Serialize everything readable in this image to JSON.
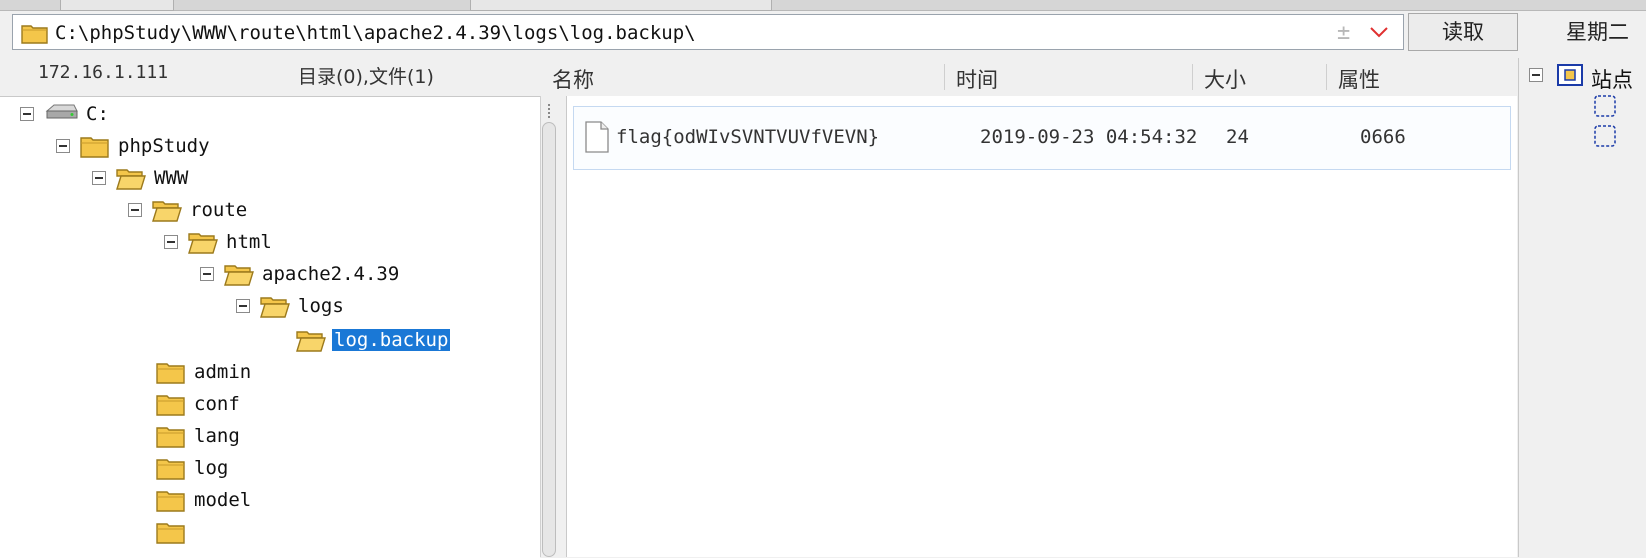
{
  "path_bar": {
    "path": "C:\\phpStudy\\WWW\\route\\html\\apache2.4.39\\logs\\log.backup\\",
    "plusminus": "±",
    "read_button": "读取"
  },
  "weekday": "星期二",
  "left_info": {
    "ip": "172.16.1.111",
    "dir_summary": "目录(0),文件(1)"
  },
  "tree": {
    "drive": "C:",
    "nodes": [
      {
        "label": "phpStudy"
      },
      {
        "label": "WWW"
      },
      {
        "label": "route"
      },
      {
        "label": "html"
      },
      {
        "label": "apache2.4.39"
      },
      {
        "label": "logs"
      },
      {
        "label": "log.backup"
      },
      {
        "label": "admin"
      },
      {
        "label": "conf"
      },
      {
        "label": "lang"
      },
      {
        "label": "log"
      },
      {
        "label": "model"
      }
    ]
  },
  "list": {
    "columns": {
      "name": "名称",
      "time": "时间",
      "size": "大小",
      "attr": "属性"
    },
    "rows": [
      {
        "name": "flag{odWIvSVNTVUVfVEVN}",
        "time": "2019-09-23 04:54:32",
        "size": "24",
        "attr": "0666"
      }
    ]
  },
  "right_panel": {
    "site_label": "站点"
  },
  "colors": {
    "selection": "#1a78d6",
    "folder": "#f4c64a",
    "accent_red": "#e03030"
  }
}
